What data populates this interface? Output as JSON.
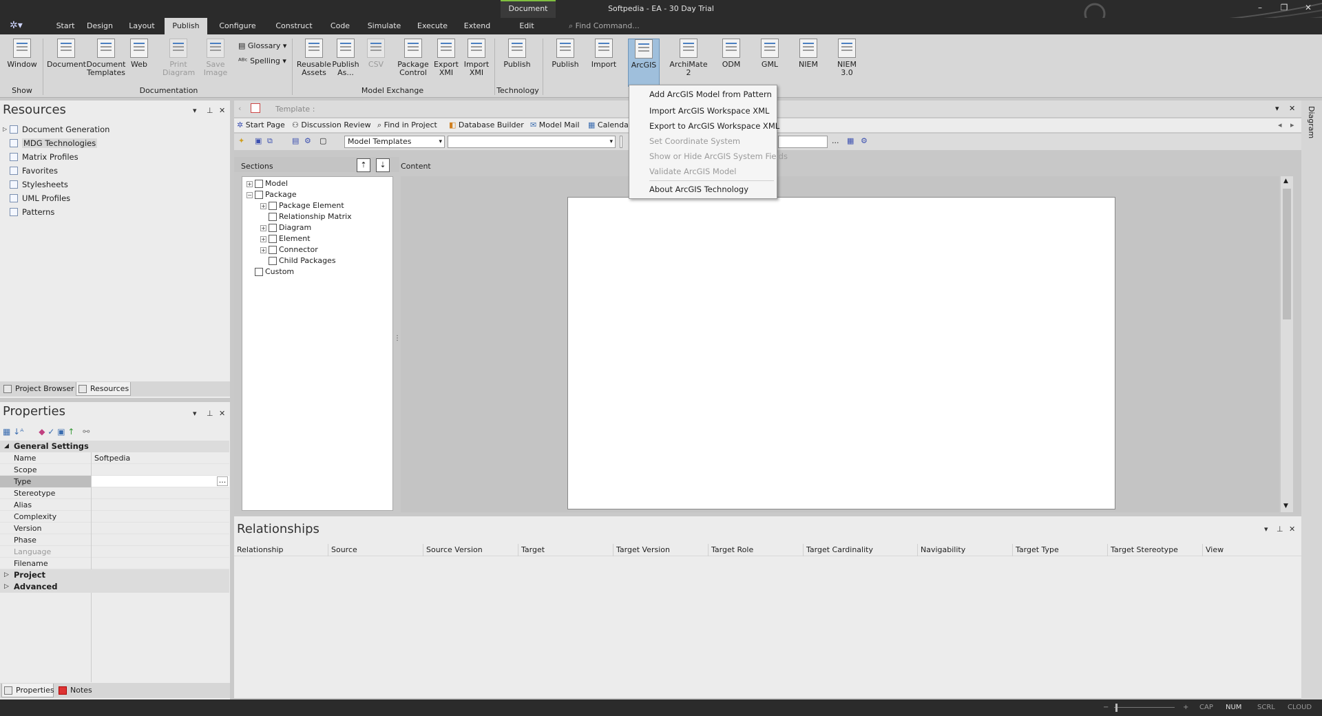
{
  "titlebar": {
    "title": "Softpedia - EA - 30 Day Trial",
    "context_tab": "Document"
  },
  "tabs": [
    "Start",
    "Design",
    "Layout",
    "Publish",
    "Configure",
    "Construct",
    "Code",
    "Simulate",
    "Execute",
    "Extend",
    "Edit"
  ],
  "find_command": "Find Command...",
  "ribbon": {
    "window": "Window",
    "document": "Document",
    "document_templates": "Document\nTemplates",
    "web": "Web",
    "print_diagram": "Print\nDiagram",
    "save_image": "Save\nImage",
    "glossary": "Glossary",
    "spelling": "Spelling",
    "reusable_assets": "Reusable\nAssets",
    "publish_as": "Publish\nAs...",
    "csv": "CSV",
    "package_control": "Package\nControl",
    "export_xmi": "Export\nXMI",
    "import_xmi": "Import\nXMI",
    "publish_tech": "Publish",
    "publish": "Publish",
    "import": "Import",
    "arcgis": "ArcGIS",
    "archimate": "ArchiMate\n2",
    "odm": "ODM",
    "gml": "GML",
    "niem": "NIEM",
    "niem30": "NIEM\n3.0",
    "groups": {
      "show": "Show",
      "documentation": "Documentation",
      "model_exchange": "Model Exchange",
      "technology": "Technology"
    }
  },
  "resources": {
    "title": "Resources",
    "items": [
      "Document Generation",
      "MDG Technologies",
      "Matrix Profiles",
      "Favorites",
      "Stylesheets",
      "UML Profiles",
      "Patterns"
    ],
    "tabs": [
      "Project Browser",
      "Resources"
    ]
  },
  "properties": {
    "title": "Properties",
    "category_general": "General Settings",
    "rows": [
      {
        "k": "Name",
        "v": "Softpedia"
      },
      {
        "k": "Scope",
        "v": ""
      },
      {
        "k": "Type",
        "v": ""
      },
      {
        "k": "Stereotype",
        "v": ""
      },
      {
        "k": "Alias",
        "v": ""
      },
      {
        "k": "Complexity",
        "v": ""
      },
      {
        "k": "Version",
        "v": ""
      },
      {
        "k": "Phase",
        "v": ""
      },
      {
        "k": "Language",
        "v": ""
      },
      {
        "k": "Filename",
        "v": ""
      }
    ],
    "category_project": "Project",
    "category_advanced": "Advanced",
    "tabs": [
      "Properties",
      "Notes"
    ],
    "ellipsis": "..."
  },
  "doc": {
    "template_label": "Template :",
    "links": [
      "Start Page",
      "Discussion Review",
      "Find in Project",
      "Database Builder",
      "Model Mail",
      "Calenda"
    ],
    "template_combo": "Model Templates",
    "sections_label": "Sections",
    "content_label": "Content",
    "ellipsis": "...",
    "tree": [
      {
        "label": "Model",
        "exp": "+",
        "level": 0
      },
      {
        "label": "Package",
        "exp": "−",
        "level": 0
      },
      {
        "label": "Package Element",
        "exp": "+",
        "level": 1
      },
      {
        "label": "Relationship Matrix",
        "exp": "",
        "level": 1
      },
      {
        "label": "Diagram",
        "exp": "+",
        "level": 1
      },
      {
        "label": "Element",
        "exp": "+",
        "level": 1
      },
      {
        "label": "Connector",
        "exp": "+",
        "level": 1
      },
      {
        "label": "Child Packages",
        "exp": "",
        "level": 1
      },
      {
        "label": "Custom",
        "exp": "",
        "level": 0
      }
    ]
  },
  "arcgis_menu": {
    "items": [
      {
        "label": "Add ArcGIS Model from Pattern",
        "enabled": true
      },
      {
        "label": "Import ArcGIS Workspace XML",
        "enabled": true
      },
      {
        "label": "Export to ArcGIS Workspace XML",
        "enabled": true
      },
      {
        "label": "Set Coordinate System",
        "enabled": false
      },
      {
        "label": "Show or Hide ArcGIS System Fields",
        "enabled": false
      },
      {
        "label": "Validate ArcGIS Model",
        "enabled": false
      },
      {
        "label": "About ArcGIS Technology",
        "enabled": true
      }
    ]
  },
  "relationships": {
    "title": "Relationships",
    "columns": [
      "Relationship",
      "Source",
      "Source Version",
      "Target",
      "Target Version",
      "Target Role",
      "Target Cardinality",
      "Navigability",
      "Target Type",
      "Target Stereotype",
      "View"
    ]
  },
  "right_strip_label": "Diagram",
  "status": {
    "cap": "CAP",
    "num": "NUM",
    "scrl": "SCRL",
    "cloud": "CLOUD",
    "minus": "−",
    "plus": "+"
  }
}
